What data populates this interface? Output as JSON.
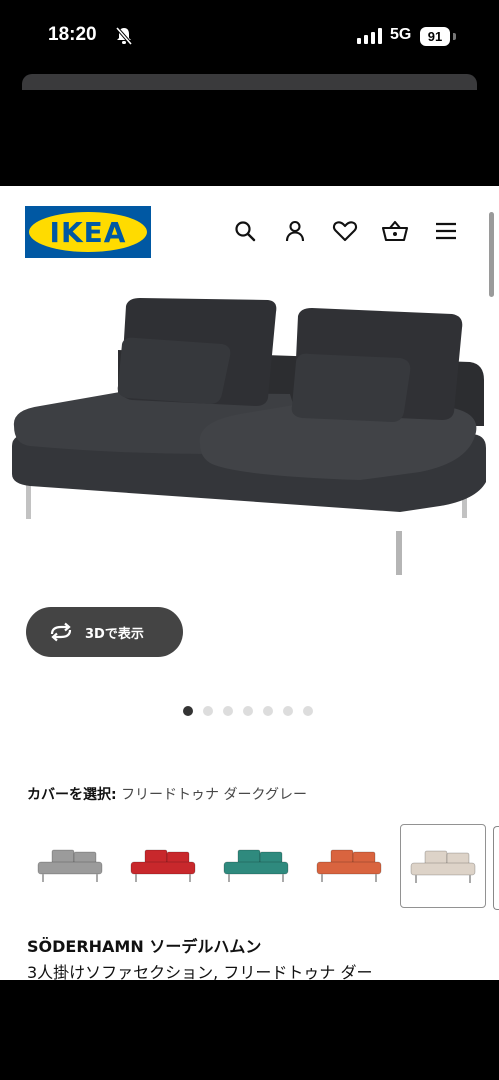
{
  "status_bar": {
    "time": "18:20",
    "network": "5G",
    "battery": "91"
  },
  "header": {
    "logo_text": "IKEA",
    "icons": [
      "search-icon",
      "account-icon",
      "heart-icon",
      "basket-icon",
      "menu-icon"
    ]
  },
  "product": {
    "view_3d_label": "3Dで表示",
    "gallery": {
      "count": 7,
      "active_index": 0
    },
    "cover": {
      "label": "カバーを選択:",
      "value": "フリードトゥナ ダークグレー"
    },
    "swatches": [
      {
        "name": "light-grey",
        "color": "#9b9b9b"
      },
      {
        "name": "red",
        "color": "#c8282c"
      },
      {
        "name": "teal",
        "color": "#2f8a7e"
      },
      {
        "name": "orange",
        "color": "#d9643f"
      },
      {
        "name": "beige",
        "color": "#ddd3c8"
      }
    ],
    "swatch_selected": 4,
    "name": "SÖDERHAMN ソーデルハムン",
    "description": "3人掛けソファセクション, フリードトゥナ ダー"
  },
  "colors": {
    "ikea_blue": "#0058a3",
    "ikea_yellow": "#ffdb00",
    "sofa": "#3b3d40"
  }
}
